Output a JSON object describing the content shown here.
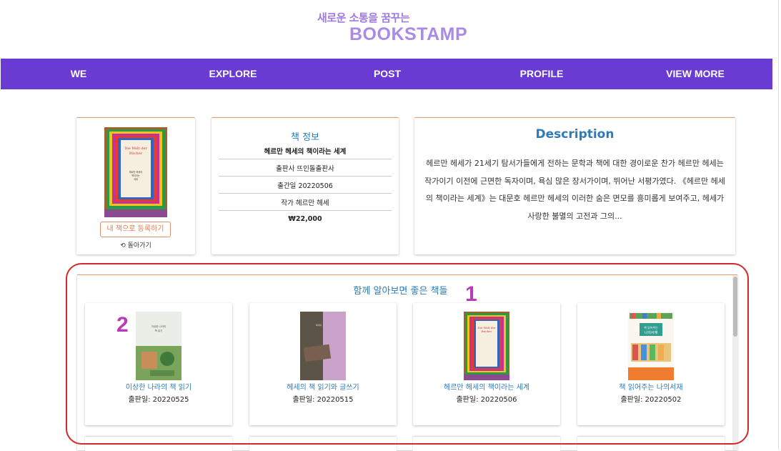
{
  "header": {
    "tagline": "새로운 소통을 꿈꾸는",
    "brand": "BOOKSTAMP"
  },
  "nav": [
    "WE",
    "EXPLORE",
    "POST",
    "PROFILE",
    "VIEW MORE"
  ],
  "book": {
    "add_button": "내 책으로 등록하기",
    "back_label": "돌아가기",
    "info_title": "책 정보",
    "name": "헤르만 헤세의 책이라는 세계",
    "publisher": "출판사 뜨인돌출판사",
    "pub_date": "출간일 20220506",
    "author": "작가 헤르만 헤세",
    "price": "₩22,000",
    "cover_text": "Die Welt der Bücher"
  },
  "description": {
    "title": "Description",
    "text": "헤르만 헤세가 21세기 탐서가들에게 전하는 문학과 책에 대한 경이로운 찬가 헤르만 헤세는 작가이기 이전에 근면한 독자이며, 욕심 많은 장서가이며, 뛰어난 서평가였다. 《헤르만 헤세의 책이라는 세계》는 대문호 헤르만 헤세의 이러한 숨은 면모를 흥미롭게 보여주고, 헤세가 사랑한 불멸의 고전과 그의..."
  },
  "related": {
    "title": "함께 알아보면 좋은 책들",
    "books": [
      {
        "title": "이상한 나라의 책 읽기",
        "date": "출판일: 20220525"
      },
      {
        "title": "헤세의 책 읽기와 글쓰기",
        "date": "출판일: 20220515"
      },
      {
        "title": "헤르만 헤세의 책이라는 세계",
        "date": "출판일: 20220506"
      },
      {
        "title": "책 읽어주는 나의서재",
        "date": "출판일: 20220502"
      }
    ]
  },
  "annotations": {
    "marker_1": "1",
    "marker_2": "2"
  },
  "colors": {
    "nav_bg": "#6a3bd3",
    "brand": "#a98ae6",
    "link_blue": "#2d7bb8",
    "accent_orange": "#e07a50",
    "annotation_red": "#d12a2a",
    "annotation_magenta": "#b93bb7"
  },
  "icons": {
    "back": "refresh-icon"
  }
}
